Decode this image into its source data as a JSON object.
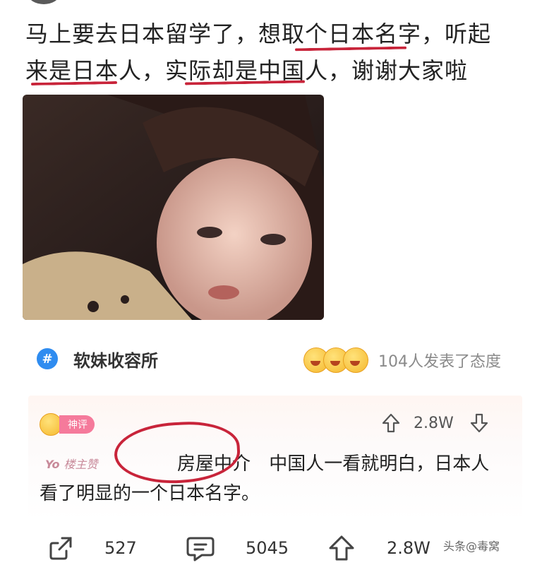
{
  "post": {
    "line1": "马上要去日本留学了，想取个日本名字，听起",
    "line2": "来是日本人，实际却是中国人，谢谢大家啦"
  },
  "topic": {
    "icon": "#",
    "name": "软妹收容所"
  },
  "reactions": {
    "count_text": "104人发表了态度"
  },
  "comment": {
    "badge": "神评",
    "upvotes": "2.8W",
    "author_tag": "Yo",
    "author_tag_extra": "楼主赞",
    "highlight": "房屋中介",
    "line1_rest": "中国人一看就明白，日本人",
    "line2": "看了明显的一个日本名字。"
  },
  "actions": {
    "shares": "527",
    "comments": "5045",
    "likes": "2.8W"
  },
  "watermark": "头条@毒窝",
  "colors": {
    "underline": "#c8243a",
    "topic_icon": "#2f8cf0",
    "badge": "#f57a9b"
  }
}
